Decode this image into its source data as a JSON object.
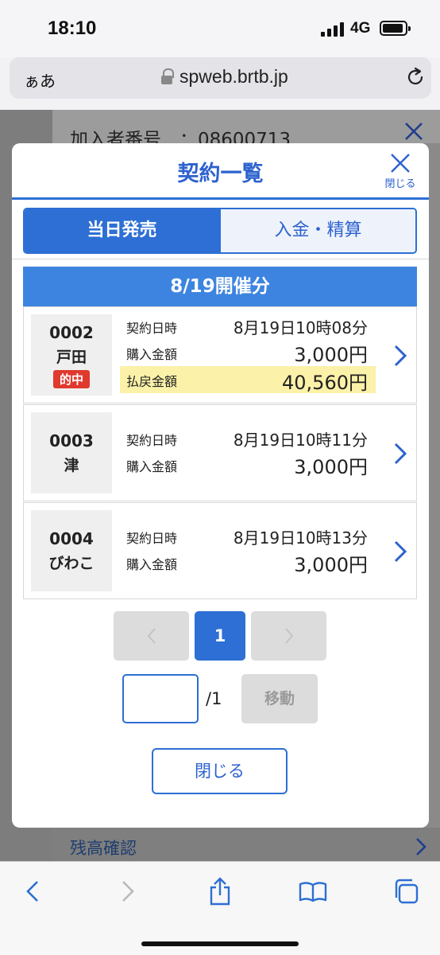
{
  "status_bar": {
    "time": "18:10",
    "network": "4G"
  },
  "browser": {
    "text_size_label": "ぁあ",
    "url": "spweb.brtb.jp"
  },
  "background_page": {
    "subscriber_line": "加入者番号　：08600713",
    "balance_link": "残高確認"
  },
  "modal": {
    "title": "契約一覧",
    "close_icon_label": "閉じる",
    "tabs": [
      {
        "label": "当日発売",
        "active": true
      },
      {
        "label": "入金・精算",
        "active": false
      }
    ],
    "date_heading": "8/19開催分",
    "contracts": [
      {
        "no": "0002",
        "venue": "戸田",
        "badge": "的中",
        "datetime_label": "契約日時",
        "datetime": "8月19日10時08分",
        "amount_label": "購入金額",
        "amount": "3,000円",
        "payout_label": "払戻金額",
        "payout": "40,560円"
      },
      {
        "no": "0003",
        "venue": "津",
        "datetime_label": "契約日時",
        "datetime": "8月19日10時11分",
        "amount_label": "購入金額",
        "amount": "3,000円"
      },
      {
        "no": "0004",
        "venue": "びわこ",
        "datetime_label": "契約日時",
        "datetime": "8月19日10時13分",
        "amount_label": "購入金額",
        "amount": "3,000円"
      }
    ],
    "pagination": {
      "current_page": "1",
      "total_pages": "/1",
      "page_input_value": "",
      "move_label": "移動"
    },
    "close_button_label": "閉じる"
  },
  "colors": {
    "accent": "#2d6fd4",
    "date_band": "#3d84e0",
    "win_badge": "#e0392e",
    "payout_highlight": "#fbf1a8"
  },
  "icons": {
    "browser": [
      "lock-icon",
      "reload-icon"
    ],
    "toolbar": [
      "back-icon",
      "forward-icon",
      "share-icon",
      "bookmarks-icon",
      "tabs-icon"
    ]
  }
}
